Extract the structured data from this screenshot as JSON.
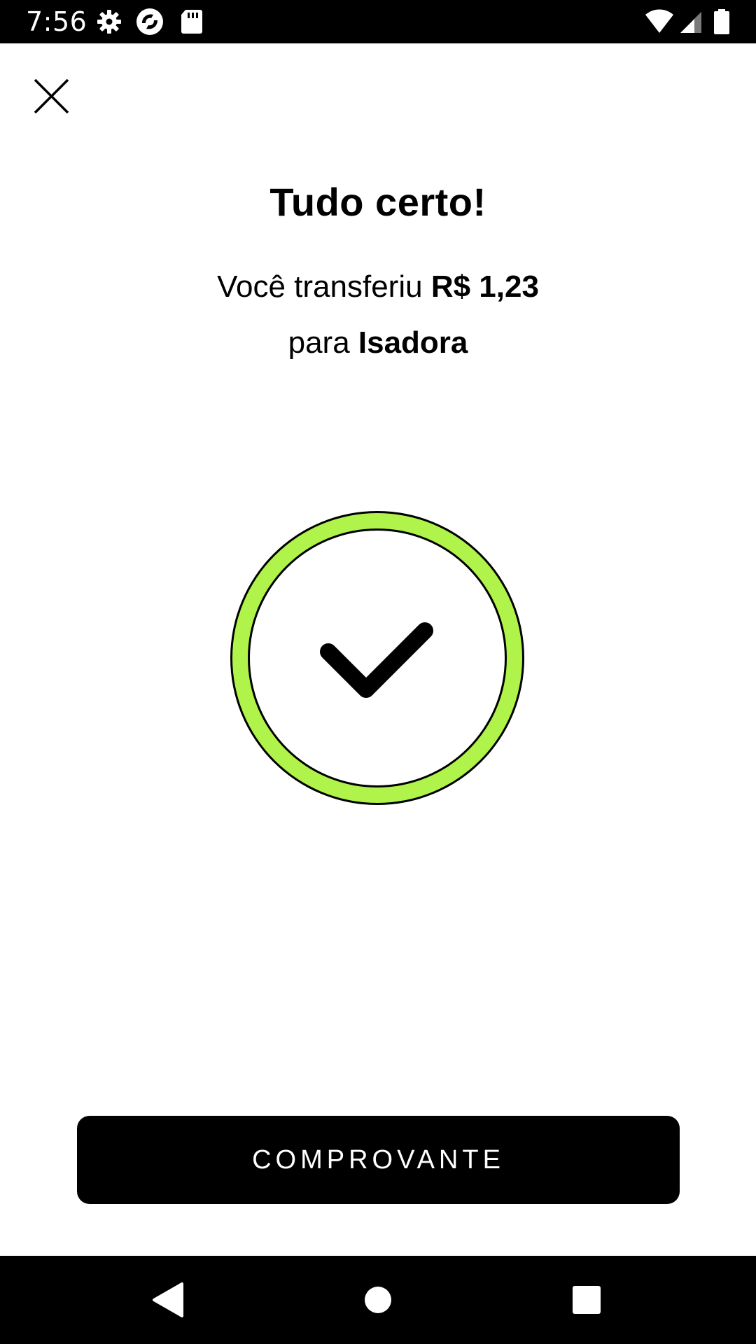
{
  "status_bar": {
    "time": "7:56",
    "icons": [
      "gear-icon",
      "sync-icon",
      "sd-card-icon",
      "wifi-icon",
      "signal-icon",
      "battery-icon"
    ]
  },
  "header": {
    "close_icon": "close-icon"
  },
  "main": {
    "title": "Tudo certo!",
    "message_prefix": "Você transferiu ",
    "amount": "R$ 1,23",
    "message_mid": "para ",
    "recipient": "Isadora",
    "success_icon": "check-circle-icon",
    "accent_color": "#B0F34A"
  },
  "footer": {
    "receipt_button_label": "COMPROVANTE"
  },
  "nav_bar": {
    "buttons": [
      "back-icon",
      "home-icon",
      "recents-icon"
    ]
  }
}
